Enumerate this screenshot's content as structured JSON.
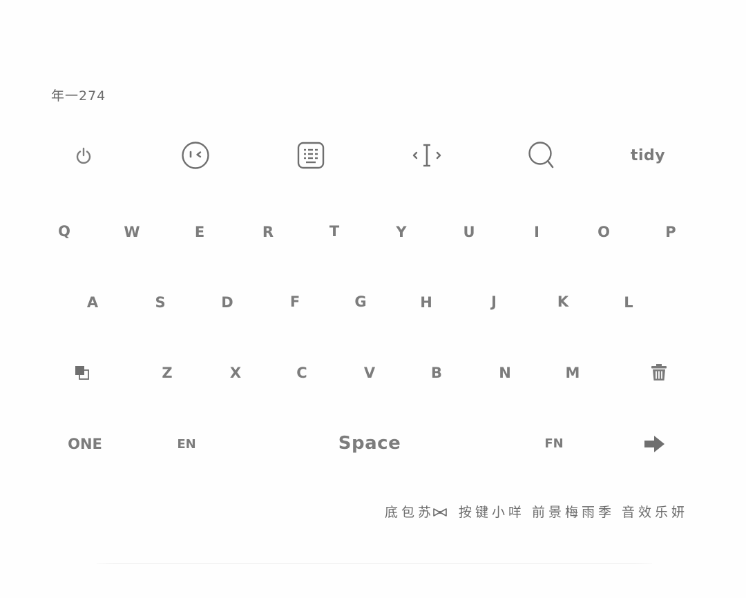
{
  "header": {
    "label": "年一274"
  },
  "toolbar": [
    {
      "name": "power-icon"
    },
    {
      "name": "emoji-face-icon"
    },
    {
      "name": "keyboard-icon"
    },
    {
      "name": "cursor-move-icon"
    },
    {
      "name": "search-icon"
    },
    {
      "name": "tidy-key",
      "label": "tidy"
    }
  ],
  "rows": {
    "row1": [
      "Q",
      "W",
      "E",
      "R",
      "T",
      "Y",
      "U",
      "I",
      "O",
      "P"
    ],
    "row2": [
      "A",
      "S",
      "D",
      "F",
      "G",
      "H",
      "J",
      "K",
      "L"
    ],
    "row3": [
      "Z",
      "X",
      "C",
      "V",
      "B",
      "N",
      "M"
    ]
  },
  "bottom": {
    "one": "ONE",
    "en": "EN",
    "space": "Space",
    "fn": "FN"
  },
  "credits": {
    "part1": "底包苏",
    "part2": "按键小咩",
    "part3": "前景梅雨季",
    "part4": "音效乐妍"
  },
  "colors": {
    "key_text": "#7c7c7c",
    "background": "#fefefe"
  }
}
